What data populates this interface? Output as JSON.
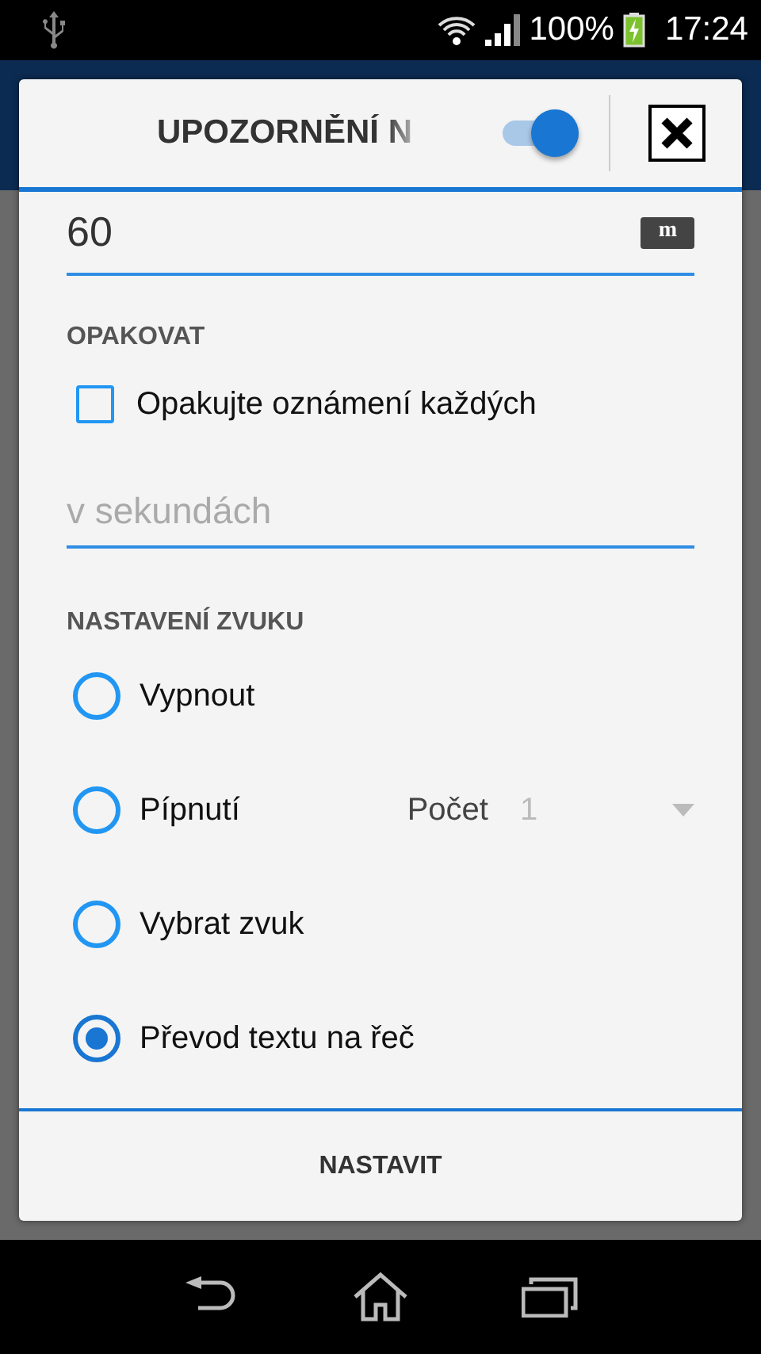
{
  "status_bar": {
    "battery": "100%",
    "time": "17:24"
  },
  "dialog": {
    "title": "UPOZORNĚNÍ N",
    "enabled": true
  },
  "duration": {
    "value": "60",
    "unit": "m"
  },
  "repeat": {
    "heading": "OPAKOVAT",
    "checkbox": {
      "label": "Opakujte oznámení každých",
      "checked": false
    },
    "interval": {
      "placeholder": "v sekundách"
    }
  },
  "sound": {
    "heading": "NASTAVENÍ ZVUKU",
    "options": [
      {
        "label": "Vypnout",
        "selected": false
      },
      {
        "label": "Pípnutí",
        "selected": false,
        "count_label": "Počet",
        "count_value": "1"
      },
      {
        "label": "Vybrat zvuk",
        "selected": false
      },
      {
        "label": "Převod textu na řeč",
        "selected": true
      }
    ]
  },
  "action": "NASTAVIT"
}
